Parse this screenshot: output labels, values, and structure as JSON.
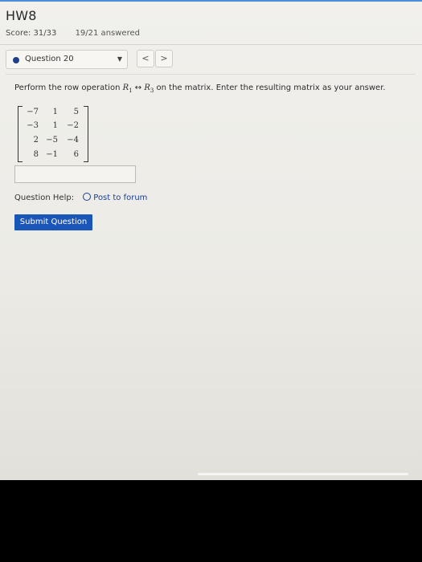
{
  "header": {
    "title": "HW8",
    "score": "Score: 31/33",
    "answered": "19/21 answered"
  },
  "question_nav": {
    "selected": "Question 20",
    "prev": "<",
    "next": ">"
  },
  "question": {
    "text_before": "Perform the row operation ",
    "r1": "R",
    "r1_sub": "1",
    "arrow": " ↔ ",
    "r3": "R",
    "r3_sub": "3",
    "text_after": " on the matrix. Enter the resulting matrix as your answer.",
    "matrix": [
      [
        "−7",
        "1",
        "5"
      ],
      [
        "−3",
        "1",
        "−2"
      ],
      [
        "2",
        "−5",
        "−4"
      ],
      [
        "8",
        "−1",
        "6"
      ]
    ]
  },
  "answer": {
    "value": ""
  },
  "help": {
    "label": "Question Help:",
    "forum": "Post to forum"
  },
  "submit_label": "Submit Question",
  "colors": {
    "accent": "#1a56b8",
    "status_dot": "#1f3f8a",
    "link": "#1c3f8f"
  }
}
